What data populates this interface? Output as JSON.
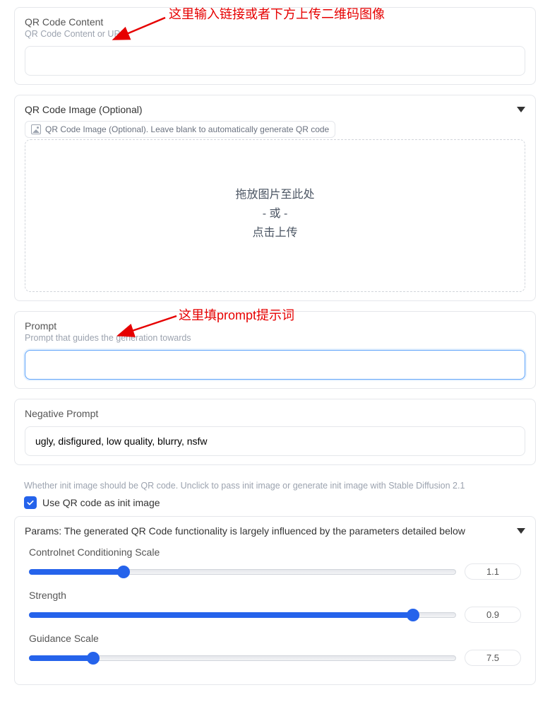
{
  "qrContent": {
    "label": "QR Code Content",
    "desc": "QR Code Content or URL",
    "value": ""
  },
  "qrImage": {
    "label": "QR Code Image (Optional)",
    "hint": "QR Code Image (Optional). Leave blank to automatically generate QR code",
    "drop1": "拖放图片至此处",
    "drop2": "- 或 -",
    "drop3": "点击上传"
  },
  "annotations": {
    "top": "这里输入链接或者下方上传二维码图像",
    "prompt": "这里填prompt提示词"
  },
  "prompt": {
    "label": "Prompt",
    "desc": "Prompt that guides the generation towards",
    "value": ""
  },
  "negative": {
    "label": "Negative Prompt",
    "value": "ugly, disfigured, low quality, blurry, nsfw"
  },
  "initCheckbox": {
    "helper": "Whether init image should be QR code. Unclick to pass init image or generate init image with Stable Diffusion 2.1",
    "label": "Use QR code as init image",
    "checked": true
  },
  "params": {
    "header": "Params: The generated QR Code functionality is largely influenced by the parameters detailed below",
    "sliders": [
      {
        "label": "Controlnet Conditioning Scale",
        "value": "1.1",
        "percent": 22
      },
      {
        "label": "Strength",
        "value": "0.9",
        "percent": 90
      },
      {
        "label": "Guidance Scale",
        "value": "7.5",
        "percent": 15
      }
    ]
  }
}
